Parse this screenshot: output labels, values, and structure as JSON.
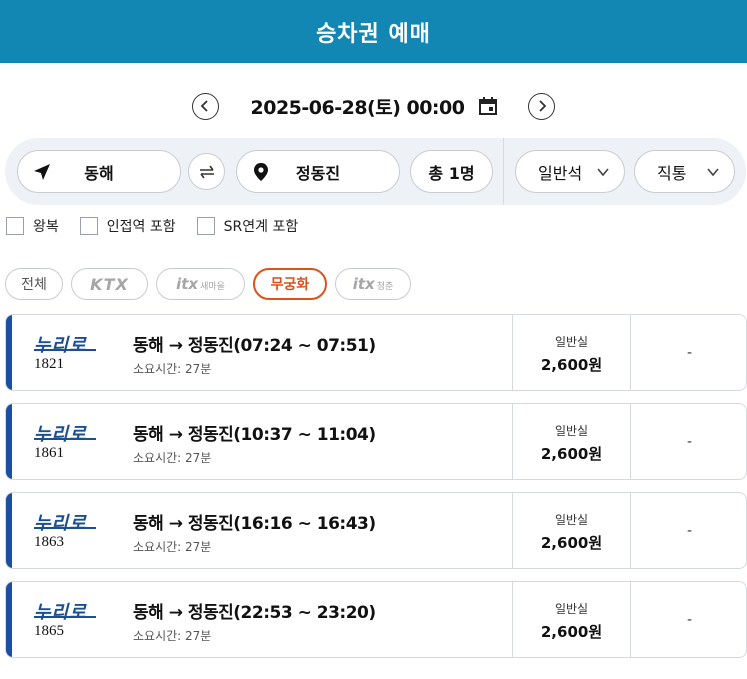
{
  "header": {
    "title": "승차권 예매"
  },
  "date": {
    "text": "2025-06-28(토) 00:00"
  },
  "search": {
    "from": "동해",
    "to": "정동진",
    "passengers": "총 1명",
    "seat_class": "일반석",
    "route_type": "직통"
  },
  "options": [
    {
      "label": "왕복"
    },
    {
      "label": "인접역 포함"
    },
    {
      "label": "SR연계 포함"
    }
  ],
  "filters": {
    "all": "전체",
    "ktx": "KTX",
    "itx_saemaeul": "itx",
    "itx_saemaeul_sub": "새마을",
    "mugunghwa": "무궁화",
    "itx_cheongchun": "itx",
    "itx_cheongchun_sub": "청춘"
  },
  "brand": "누리로",
  "trains": [
    {
      "number": "1821",
      "route": "동해 → 정동진(07:24 ~ 07:51)",
      "duration": "소요시간: 27분",
      "class": "일반실",
      "price": "2,600원",
      "extra": "-"
    },
    {
      "number": "1861",
      "route": "동해 → 정동진(10:37 ~ 11:04)",
      "duration": "소요시간: 27분",
      "class": "일반실",
      "price": "2,600원",
      "extra": "-"
    },
    {
      "number": "1863",
      "route": "동해 → 정동진(16:16 ~ 16:43)",
      "duration": "소요시간: 27분",
      "class": "일반실",
      "price": "2,600원",
      "extra": "-"
    },
    {
      "number": "1865",
      "route": "동해 → 정동진(22:53 ~ 23:20)",
      "duration": "소요시간: 27분",
      "class": "일반실",
      "price": "2,600원",
      "extra": "-"
    }
  ],
  "colors": {
    "header": "#1287b3",
    "accent": "#1b4fa0",
    "active_filter": "#d9541a"
  }
}
